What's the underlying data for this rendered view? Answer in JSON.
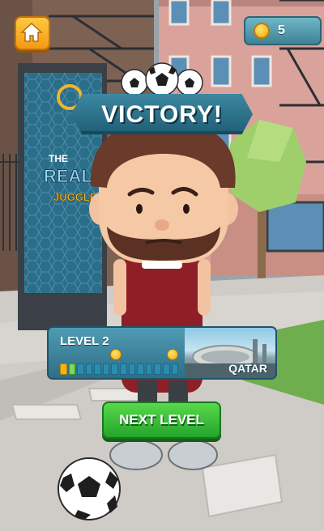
{
  "hud": {
    "coins": "5"
  },
  "result": {
    "title": "VICTORY!"
  },
  "level_card": {
    "level_label": "LEVEL 2",
    "country": "QATAR",
    "progress": {
      "filled_segments": 2,
      "total_segments": 14
    }
  },
  "actions": {
    "next_label": "NEXT LEVEL"
  },
  "poster": {
    "line1": "THE",
    "line2": "REAL",
    "line3": "JUGGLE"
  },
  "colors": {
    "banner": "#2b7690",
    "button_green": "#33b83a",
    "home_orange": "#f6a623",
    "coin_gold": "#f5b51a"
  }
}
